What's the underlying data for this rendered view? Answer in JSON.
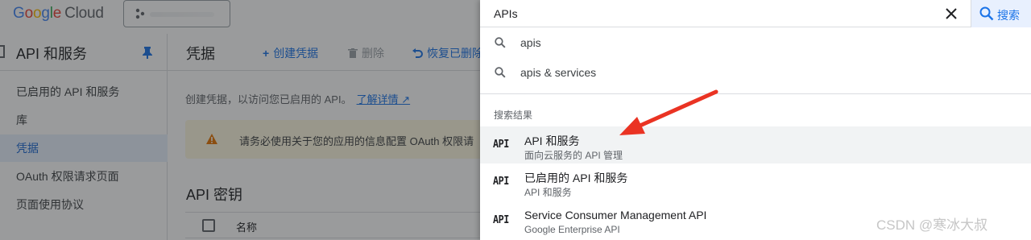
{
  "header": {
    "logo_google": [
      "G",
      "o",
      "o",
      "g",
      "l",
      "e"
    ],
    "logo_cloud": "Cloud"
  },
  "sidebar": {
    "title": "API 和服务",
    "items": [
      {
        "label": "已启用的 API 和服务"
      },
      {
        "label": "库"
      },
      {
        "label": "凭据",
        "active": true
      },
      {
        "label": "OAuth 权限请求页面"
      },
      {
        "label": "页面使用协议"
      }
    ]
  },
  "main": {
    "title": "凭据",
    "create_label": "创建凭据",
    "delete_label": "删除",
    "restore_label": "恢复已删除",
    "description": "创建凭据，以访问您已启用的 API。",
    "learn_more": "了解详情",
    "banner_text": "请务必使用关于您的应用的信息配置 OAuth 权限请",
    "api_keys_title": "API 密钥",
    "column_name": "名称"
  },
  "search": {
    "query": "APIs",
    "button_label": "搜索",
    "suggestions": [
      {
        "text": "apis"
      },
      {
        "text": "apis & services"
      }
    ],
    "results_heading": "搜索结果",
    "results": [
      {
        "icon": "API",
        "title": "API 和服务",
        "subtitle": "面向云服务的 API 管理",
        "highlighted": true
      },
      {
        "icon": "API",
        "title": "已启用的 API 和服务",
        "subtitle": "API 和服务"
      },
      {
        "icon": "API",
        "title": "Service Consumer Management API",
        "subtitle": "Google Enterprise API"
      }
    ]
  },
  "watermark": "CSDN @寒冰大叔",
  "colors": {
    "accent": "#1a73e8",
    "annotation_arrow": "#ea3323",
    "warning": "#e37400"
  }
}
